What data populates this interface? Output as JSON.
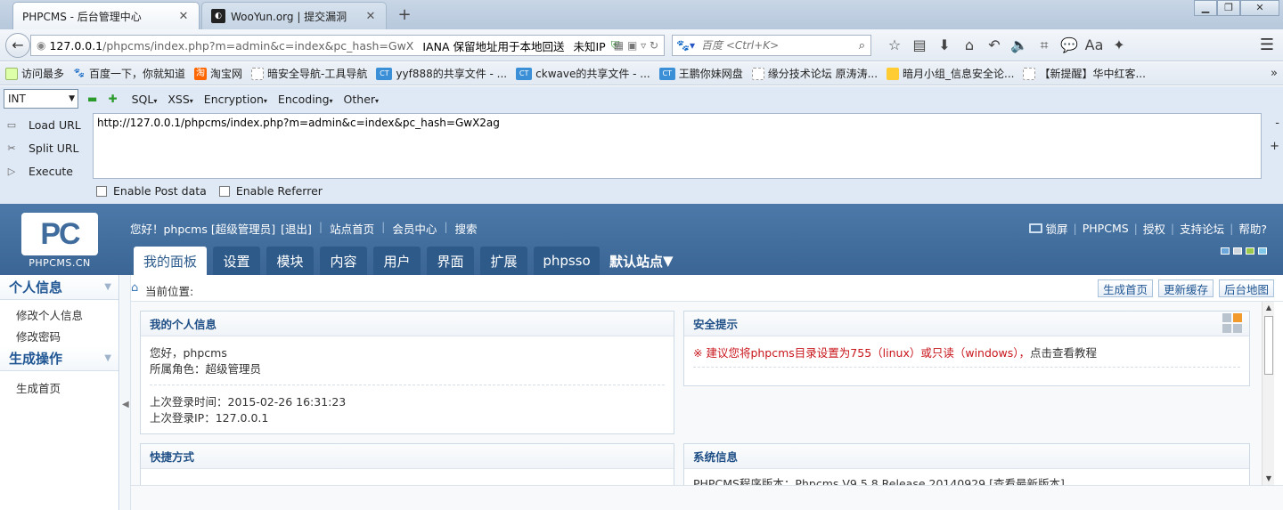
{
  "browser": {
    "tabs": [
      {
        "label": "PHPCMS - 后台管理中心",
        "active": true
      },
      {
        "label": "WooYun.org | 提交漏洞",
        "active": false
      }
    ],
    "new_tab_label": "+",
    "url": {
      "host": "127.0.0.1",
      "path": "/phpcms/index.php?m=admin&c=index&pc_hash=GwX",
      "extra": "IANA 保留地址用于本地回送",
      "status": "未知IP"
    },
    "search": {
      "placeholder": "百度 <Ctrl+K>"
    }
  },
  "bookmarks": [
    {
      "label": "访问最多",
      "icon": "folder"
    },
    {
      "label": "百度一下，你就知道",
      "icon": "paw"
    },
    {
      "label": "淘宝网",
      "icon": "tb"
    },
    {
      "label": "暗安全导航-工具导航",
      "icon": "blank"
    },
    {
      "label": "yyf888的共享文件 - ...",
      "icon": "ct"
    },
    {
      "label": "ckwave的共享文件 - ...",
      "icon": "ct"
    },
    {
      "label": "王鹏你妹网盘",
      "icon": "ct"
    },
    {
      "label": "缘分技术论坛 原涛涛...",
      "icon": "blank"
    },
    {
      "label": "暗月小组_信息安全论...",
      "icon": "star"
    },
    {
      "label": "【新提醒】华中红客...",
      "icon": "blank"
    }
  ],
  "hackbar": {
    "select_value": "INT",
    "menus": [
      "SQL",
      "XSS",
      "Encryption",
      "Encoding",
      "Other"
    ],
    "buttons": {
      "load": "Load URL",
      "split": "Split URL",
      "execute": "Execute"
    },
    "url_text": "http://127.0.0.1/phpcms/index.php?m=admin&c=index&pc_hash=GwX2ag",
    "enable_post": "Enable Post data",
    "enable_referrer": "Enable Referrer"
  },
  "cms": {
    "logo_text": "PC",
    "logo_site": "PHPCMS.CN",
    "top_left": [
      "您好！phpcms [超级管理员]",
      "[退出]",
      "站点首页",
      "会员中心",
      "搜索"
    ],
    "top_right": [
      "锁屏",
      "PHPCMS",
      "授权",
      "支持论坛",
      "帮助?"
    ],
    "main_tabs": [
      "我的面板",
      "设置",
      "模块",
      "内容",
      "用户",
      "界面",
      "扩展",
      "phpsso"
    ],
    "site_selector": "默认站点",
    "left_sections": [
      {
        "title": "个人信息",
        "items": [
          "修改个人信息",
          "修改密码"
        ]
      },
      {
        "title": "生成操作",
        "items": [
          "生成首页"
        ]
      }
    ],
    "breadcrumb_label": "当前位置:",
    "crumb_buttons": [
      "生成首页",
      "更新缓存",
      "后台地图"
    ],
    "panels": {
      "info": {
        "title": "我的个人信息",
        "greeting": "您好，phpcms",
        "role": "所属角色：超级管理员",
        "last_login_time": "上次登录时间：2015-02-26 16:31:23",
        "last_login_ip": "上次登录IP：127.0.0.1"
      },
      "security": {
        "title": "安全提示",
        "warning": "※ 建议您将phpcms目录设置为755（linux）或只读（windows），",
        "warning_link": "点击查看教程"
      },
      "quick": {
        "title": "快捷方式"
      },
      "system": {
        "title": "系统信息",
        "version_line": "PHPCMS程序版本：Phpcms V9.5.8 Release 20140929 [查看最新版本]"
      }
    }
  }
}
